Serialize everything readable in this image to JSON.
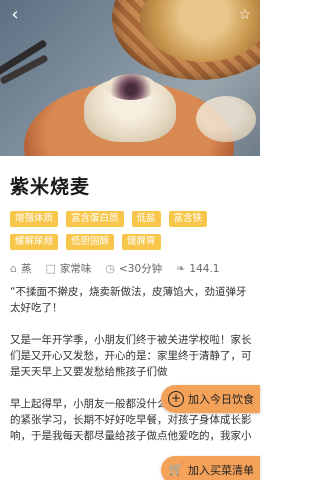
{
  "header": {
    "back_icon": "chevron-left-icon",
    "star_icon": "star-outline-icon"
  },
  "recipe": {
    "title": "紫米烧麦",
    "tags": [
      "增强体质",
      "富含蛋白质",
      "低盐",
      "富含铁",
      "缓解尿频",
      "低胆固醇",
      "健脾胃"
    ],
    "tag_color": "#f7c64a",
    "meta": {
      "method": "蒸",
      "taste": "家常味",
      "time": "<30分钟",
      "calories": "144.1"
    },
    "description": [
      "“不揉面不擀皮，烧卖新做法，皮薄馅大，劲道弹牙太好吃了！",
      "又是一年开学季，小朋友们终于被关进学校啦！家长们是又开心又发愁，开心的是：家里终于清静了，可是天天早上又要发愁给熊孩子们做",
      "早上起得早，小朋友一般都没什么食欲，但是一上午的紧张学习，长期不好好吃早餐，对孩子身体成长影响，于是我每天都尽量给孩子做点他爱吃的，我家小"
    ]
  },
  "actions": {
    "add_today": "加入今日饮食",
    "add_shopping": "加入买菜清单",
    "accent_color": "#f4a15a"
  }
}
